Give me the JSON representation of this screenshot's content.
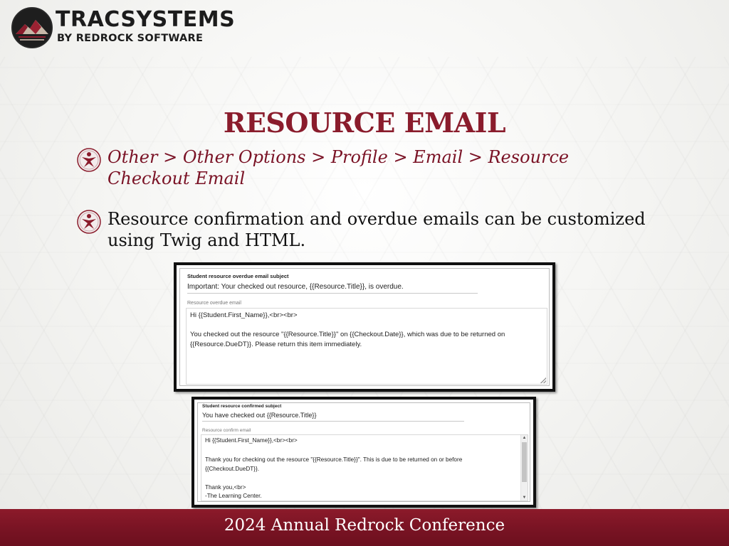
{
  "logo": {
    "brand": "TRACSYSTEMS",
    "tagline": "BY REDROCK SOFTWARE",
    "icon": "mountain-logo-icon"
  },
  "slide": {
    "title": "RESOURCE EMAIL",
    "bullets": [
      {
        "text": "Other > Other Options > Profile > Email > Resource Checkout Email",
        "icon": "tracsystems-figure-icon"
      },
      {
        "text": "Resource confirmation and overdue emails can be customized using Twig and HTML.",
        "icon": "tracsystems-figure-icon"
      }
    ]
  },
  "overdue_form": {
    "subject_label": "Student resource overdue email subject",
    "subject_value": "Important: Your checked out resource, {{Resource.Title}}, is overdue.",
    "body_label": "Resource overdue email",
    "body_lines": [
      "Hi {{Student.First_Name}},<br><br>",
      "",
      "You checked out the resource \"{{Resource.Title}}\" on {{Checkout.Date}}, which was due to be returned on",
      "{{Resource.DueDT}}. Please return this item immediately."
    ]
  },
  "confirm_form": {
    "subject_label": "Student resource confirmed subject",
    "subject_value": "You have checked out {{Resource.Title}}",
    "body_label": "Resource confirm email",
    "body_lines": [
      "Hi {{Student.First_Name}},<br><br>",
      "",
      "Thank you for checking out the resource \"{{Resource.Title}}\". This is due to be returned on or before",
      "{{Checkout.DueDT}}.",
      "",
      "Thank you,<br>",
      "-The Learning Center."
    ],
    "scroll_up": "▲",
    "scroll_down": "▼"
  },
  "footer": {
    "text": "2024 Annual Redrock Conference"
  },
  "colors": {
    "accent": "#8a1c2c",
    "footer": "#7a1424"
  }
}
